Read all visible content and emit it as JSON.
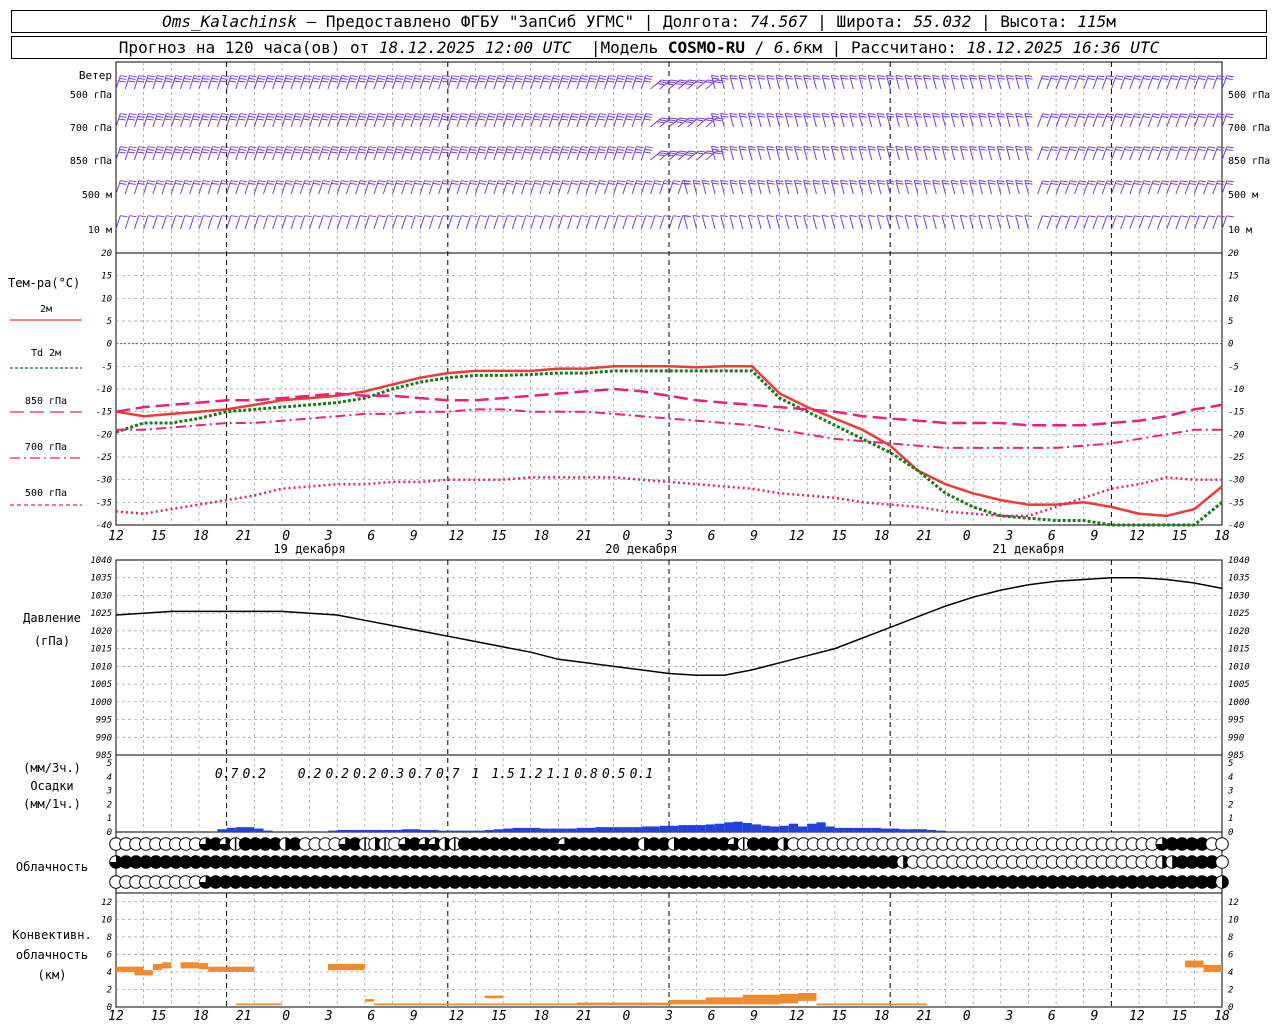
{
  "header": {
    "station": "Oms_Kalachinsk",
    "provided": "— Предоставлено ФГБУ \"ЗапСиб УГМС\"",
    "lon_label": "Долгота:",
    "lon": "74.567",
    "lat_label": "Широта:",
    "lat": "55.032",
    "alt_label": "Высота:",
    "alt": "115",
    "alt_unit": "м",
    "forecast_label": "Прогноз на 120 часа(ов) от",
    "forecast_from": "18.12.2025 12:00 UTC",
    "model_label": "Модель",
    "model": "COSMO-RU",
    "resolution": "6.6",
    "res_unit": "км",
    "calc_label": "Рассчитано:",
    "calc_time": "18.12.2025 16:36 UTC"
  },
  "colors": {
    "wind": "#7a3cd6",
    "t2m": "#f03a3a",
    "td": "#1a7a1a",
    "p850": "#e8207f",
    "p700": "#e8207f",
    "p500": "#e0207f",
    "zero_line": "#3a5ae0",
    "pressure": "#000000",
    "precip": "#2040e0",
    "conv": "#f08a30",
    "grid": "#999999"
  },
  "chart_data": [
    {
      "type": "wind-barbs",
      "title": "Ветер",
      "levels": [
        "500 гПа",
        "700 гПа",
        "850 гПа",
        "500 м",
        "10 м"
      ],
      "note": "wind barbs for 5 levels, hourly"
    },
    {
      "type": "line",
      "ylabel": "Тем-ра(°C)",
      "ylim": [
        -40,
        20
      ],
      "yticks": [
        20,
        15,
        10,
        5,
        0,
        -5,
        -10,
        -15,
        -20,
        -25,
        -30,
        -35,
        -40
      ],
      "x_hours": [
        0,
        3,
        6,
        9,
        12,
        15,
        18,
        21,
        24,
        27,
        30,
        33,
        36,
        39,
        42,
        45,
        48,
        51,
        54,
        57,
        60,
        63,
        66,
        69,
        72,
        75,
        78,
        81,
        84,
        87,
        90,
        93,
        96,
        99,
        102,
        105,
        108,
        111,
        114,
        117,
        120
      ],
      "series": [
        {
          "name": "2м",
          "style": "solid",
          "values": [
            -15,
            -16,
            -15.5,
            -15,
            -14.5,
            -13.5,
            -12.5,
            -12,
            -11.5,
            -10.5,
            -9,
            -7.5,
            -6.5,
            -6,
            -6,
            -6,
            -5.5,
            -5.5,
            -5,
            -5,
            -5,
            -5.2,
            -5,
            -5,
            -11,
            -14,
            -16.5,
            -19,
            -22.5,
            -28,
            -31,
            -33,
            -34.5,
            -35.5,
            -35.5,
            -35,
            -36,
            -37.5,
            -38,
            -36.5,
            -31.5
          ]
        },
        {
          "name": "Td 2м",
          "style": "dotted",
          "values": [
            -19.5,
            -17.5,
            -17.5,
            -16.5,
            -15,
            -14.5,
            -14,
            -13.5,
            -13,
            -12,
            -10,
            -8.5,
            -7.5,
            -7,
            -7,
            -6.8,
            -6.5,
            -6.5,
            -6,
            -6,
            -6,
            -6,
            -6,
            -6,
            -12,
            -15,
            -18,
            -21,
            -24,
            -28,
            -33,
            -36,
            -38,
            -38.5,
            -39,
            -39,
            -40,
            -41,
            -42,
            -41,
            -35
          ]
        },
        {
          "name": "850 гПа",
          "style": "long-dash",
          "values": [
            -15,
            -14,
            -13.5,
            -13,
            -12.5,
            -12.5,
            -12,
            -11.5,
            -11,
            -11.5,
            -11.5,
            -12,
            -12.5,
            -12.5,
            -12,
            -11.5,
            -11,
            -10.5,
            -10,
            -10.5,
            -11.5,
            -12.5,
            -13,
            -13.5,
            -14,
            -14.5,
            -15,
            -16,
            -16.5,
            -17,
            -17.5,
            -17.5,
            -17.5,
            -18,
            -18,
            -18,
            -17.5,
            -17,
            -16,
            -14.5,
            -13.5
          ]
        },
        {
          "name": "700 гПа",
          "style": "dash-dot",
          "values": [
            -19,
            -19,
            -18.5,
            -18,
            -17.5,
            -17.5,
            -17,
            -16.5,
            -16,
            -15.5,
            -15.5,
            -15,
            -15,
            -14.5,
            -14.5,
            -15,
            -15,
            -15,
            -15.5,
            -16,
            -16.5,
            -17,
            -17.5,
            -18,
            -19,
            -20,
            -21,
            -21.5,
            -22,
            -22.5,
            -23,
            -23,
            -23,
            -23,
            -23,
            -22.5,
            -22,
            -21,
            -20,
            -19,
            -19
          ]
        },
        {
          "name": "500 гПа",
          "style": "dotted",
          "values": [
            -37,
            -37.5,
            -36.5,
            -35.5,
            -34.5,
            -33.5,
            -32,
            -31.5,
            -31,
            -31,
            -30.5,
            -30.5,
            -30,
            -30,
            -30,
            -29.5,
            -29.5,
            -29.5,
            -29.5,
            -30,
            -30.5,
            -31,
            -31.5,
            -32,
            -33,
            -33.5,
            -34,
            -35,
            -35.5,
            -36,
            -37,
            -37.5,
            -38,
            -38,
            -36,
            -34,
            -32,
            -31,
            -29.5,
            -30,
            -30
          ]
        }
      ],
      "xticks": [
        "12",
        "15",
        "18",
        "21",
        "0",
        "3",
        "6",
        "9",
        "12",
        "15",
        "18",
        "21",
        "0",
        "3",
        "6",
        "9",
        "12",
        "15",
        "18",
        "21",
        "0",
        "3",
        "6",
        "9",
        "12",
        "15",
        "18"
      ],
      "day_labels": [
        "19 декабря",
        "20 декабря",
        "21 декабря"
      ]
    },
    {
      "type": "line",
      "ylabel": "Давление",
      "yunit": "(гПа)",
      "ylim": [
        985,
        1040
      ],
      "yticks": [
        1040,
        1035,
        1030,
        1025,
        1020,
        1015,
        1010,
        1005,
        1000,
        995,
        990,
        985
      ],
      "x_hours": [
        0,
        3,
        6,
        9,
        12,
        15,
        18,
        21,
        24,
        27,
        30,
        33,
        36,
        39,
        42,
        45,
        48,
        51,
        54,
        57,
        60,
        63,
        66,
        69,
        72,
        75,
        78,
        81,
        84,
        87,
        90,
        93,
        96,
        99,
        102,
        105,
        108,
        111,
        114,
        117,
        120
      ],
      "values": [
        1024.5,
        1025,
        1025.5,
        1025.5,
        1025.5,
        1025.5,
        1025.5,
        1025,
        1024.5,
        1023,
        1021.5,
        1020,
        1018.5,
        1017,
        1015.5,
        1014,
        1012,
        1011,
        1010,
        1009,
        1008,
        1007.5,
        1007.5,
        1009,
        1011,
        1013,
        1015,
        1018,
        1021,
        1024,
        1027,
        1029.5,
        1031.5,
        1033,
        1034,
        1034.5,
        1035,
        1035,
        1034.5,
        1033.5,
        1032
      ]
    },
    {
      "type": "bar",
      "ylabel": "Осадки",
      "yunits": [
        "(мм/3ч.)",
        "(мм/1ч.)"
      ],
      "ylim": [
        0,
        5
      ],
      "yticks": [
        5,
        4,
        3,
        2,
        1,
        0
      ],
      "labels_3h": [
        {
          "h": 12,
          "v": "0.7"
        },
        {
          "h": 15,
          "v": "0.2"
        },
        {
          "h": 21,
          "v": "0.2"
        },
        {
          "h": 24,
          "v": "0.2"
        },
        {
          "h": 27,
          "v": "0.2"
        },
        {
          "h": 30,
          "v": "0.3"
        },
        {
          "h": 33,
          "v": "0.7"
        },
        {
          "h": 36,
          "v": "0.7"
        },
        {
          "h": 39,
          "v": "1"
        },
        {
          "h": 42,
          "v": "1.5"
        },
        {
          "h": 45,
          "v": "1.2"
        },
        {
          "h": 48,
          "v": "1.1"
        },
        {
          "h": 51,
          "v": "0.8"
        },
        {
          "h": 54,
          "v": "0.5"
        },
        {
          "h": 57,
          "v": "0.1"
        }
      ],
      "hourly": [
        0,
        0,
        0,
        0,
        0,
        0,
        0,
        0,
        0,
        0,
        0,
        0.2,
        0.3,
        0.35,
        0.35,
        0.25,
        0.1,
        0.05,
        0,
        0,
        0,
        0,
        0.05,
        0.1,
        0.15,
        0.15,
        0.15,
        0.15,
        0.15,
        0.15,
        0.15,
        0.2,
        0.2,
        0.15,
        0.15,
        0.1,
        0.1,
        0.1,
        0.1,
        0.1,
        0.15,
        0.2,
        0.25,
        0.3,
        0.3,
        0.3,
        0.25,
        0.25,
        0.25,
        0.25,
        0.3,
        0.3,
        0.35,
        0.35,
        0.35,
        0.35,
        0.35,
        0.4,
        0.4,
        0.45,
        0.45,
        0.5,
        0.5,
        0.5,
        0.55,
        0.6,
        0.7,
        0.75,
        0.65,
        0.55,
        0.45,
        0.4,
        0.45,
        0.6,
        0.4,
        0.6,
        0.7,
        0.4,
        0.3,
        0.3,
        0.3,
        0.3,
        0.3,
        0.25,
        0.25,
        0.2,
        0.2,
        0.2,
        0.15,
        0.1,
        0.05,
        0.05,
        0,
        0,
        0,
        0,
        0,
        0,
        0,
        0,
        0,
        0,
        0,
        0,
        0,
        0,
        0,
        0,
        0,
        0,
        0,
        0,
        0,
        0,
        0,
        0,
        0,
        0,
        0,
        0,
        0
      ]
    },
    {
      "type": "cloud-symbols",
      "title": "Облачность",
      "rows": [
        "0000000003431444424000034121034332144444444443444444424424444431444200000000000000000000000000000000000003444400",
        "3444444444444444444444444444444444444444444444444444444444444444444444444444444200000000000000000000000002244440",
        "0000000003444444444444444444444444444444444444444444444444444444444444444444444444444444444444444444444444444442"
      ]
    },
    {
      "type": "bar",
      "ylabel": "Конвективн.",
      "ylabel2": "облачность",
      "yunit": "(км)",
      "ylim": [
        0,
        13
      ],
      "yticks": [
        12,
        10,
        8,
        6,
        4,
        2,
        0
      ],
      "segments": [
        {
          "h0": 0,
          "h1": 2,
          "bot": 4,
          "top": 4.6
        },
        {
          "h0": 2,
          "h1": 3,
          "bot": 4,
          "top": 4.6
        },
        {
          "h0": 2,
          "h1": 4,
          "bot": 3.6,
          "top": 4.2
        },
        {
          "h0": 4,
          "h1": 5,
          "bot": 4.2,
          "top": 4.9
        },
        {
          "h0": 5,
          "h1": 6,
          "bot": 4.4,
          "top": 5.1
        },
        {
          "h0": 7,
          "h1": 9,
          "bot": 4.4,
          "top": 5.1
        },
        {
          "h0": 9,
          "h1": 10,
          "bot": 4.3,
          "top": 5.0
        },
        {
          "h0": 10,
          "h1": 12,
          "bot": 4.0,
          "top": 4.6
        },
        {
          "h0": 12,
          "h1": 15,
          "bot": 4.0,
          "top": 4.6
        },
        {
          "h0": 23,
          "h1": 27,
          "bot": 4.2,
          "top": 4.9
        },
        {
          "h0": 13,
          "h1": 18,
          "bot": 0.2,
          "top": 0.4
        },
        {
          "h0": 27,
          "h1": 28,
          "bot": 0.6,
          "top": 0.9
        },
        {
          "h0": 28,
          "h1": 50,
          "bot": 0.2,
          "top": 0.4
        },
        {
          "h0": 40,
          "h1": 42,
          "bot": 1.0,
          "top": 1.3
        },
        {
          "h0": 50,
          "h1": 60,
          "bot": 0.2,
          "top": 0.5
        },
        {
          "h0": 60,
          "h1": 64,
          "bot": 0.3,
          "top": 0.8
        },
        {
          "h0": 64,
          "h1": 68,
          "bot": 0.3,
          "top": 1.1
        },
        {
          "h0": 68,
          "h1": 72,
          "bot": 0.3,
          "top": 1.4
        },
        {
          "h0": 72,
          "h1": 74,
          "bot": 0.4,
          "top": 1.5
        },
        {
          "h0": 74,
          "h1": 76,
          "bot": 0.7,
          "top": 1.6
        },
        {
          "h0": 76,
          "h1": 80,
          "bot": 0.2,
          "top": 0.4
        },
        {
          "h0": 80,
          "h1": 88,
          "bot": 0.2,
          "top": 0.4
        },
        {
          "h0": 116,
          "h1": 118,
          "bot": 4.5,
          "top": 5.3
        },
        {
          "h0": 118,
          "h1": 120,
          "bot": 4.0,
          "top": 4.8
        }
      ]
    }
  ]
}
